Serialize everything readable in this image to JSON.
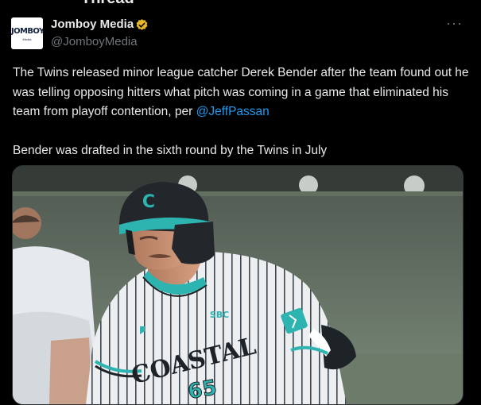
{
  "header": {
    "title": "Thread"
  },
  "tweet": {
    "author": {
      "display_name": "Jomboy Media",
      "handle": "@JomboyMedia",
      "avatar_text": "JOMBOY",
      "avatar_subtext": "Media",
      "verified_icon": "verified-badge-gold"
    },
    "more_label": "···",
    "text_before_mention": "The Twins released minor league catcher Derek Bender after the team found out he was telling opposing hitters what pitch was coming in a game that eliminated his team from playoff contention, per ",
    "mention": "@JeffPassan",
    "text_second_paragraph": "Bender was drafted in the sixth round by the Twins in July",
    "media": {
      "helmet_letter": "C",
      "jersey_text": "COASTAL",
      "jersey_number": "65",
      "patch_text": "SBC"
    }
  },
  "colors": {
    "background": "#000000",
    "text": "#e7e9ea",
    "secondary": "#71767b",
    "link": "#1d9bf0",
    "verified": "#e8b829",
    "team_teal": "#2db3b0"
  }
}
